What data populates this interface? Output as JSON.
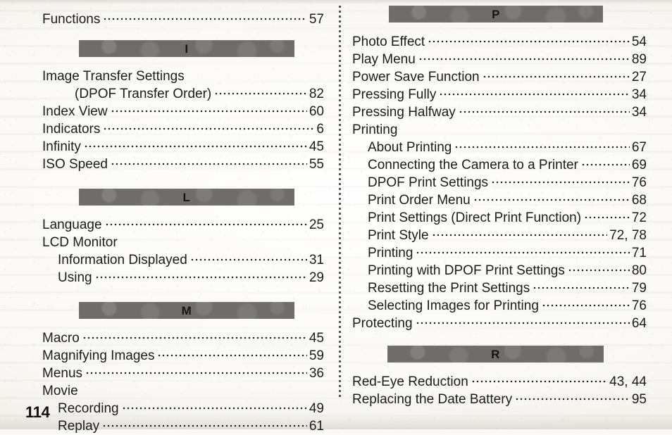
{
  "document": {
    "page_number": "114",
    "type": "index",
    "colors": {
      "section_bar": "#6e6d6a",
      "paper": "#faf9f6",
      "text": "#1c1b1a"
    }
  },
  "left_column": {
    "blocks": [
      {
        "kind": "entries",
        "entries": [
          {
            "label": "Functions",
            "level": 0,
            "page": "57",
            "leader": true
          }
        ]
      },
      {
        "kind": "section",
        "letter": "I"
      },
      {
        "kind": "entries",
        "entries": [
          {
            "label": "Image Transfer Settings",
            "level": 0,
            "page": "",
            "leader": false
          },
          {
            "label": "(DPOF Transfer Order)",
            "level": 2,
            "page": "82",
            "leader": true
          },
          {
            "label": "Index View",
            "level": 0,
            "page": "60",
            "leader": true
          },
          {
            "label": "Indicators",
            "level": 0,
            "page": "6",
            "leader": true
          },
          {
            "label": "Infinity",
            "level": 0,
            "page": "45",
            "leader": true
          },
          {
            "label": "ISO Speed",
            "level": 0,
            "page": "55",
            "leader": true
          }
        ]
      },
      {
        "kind": "section",
        "letter": "L"
      },
      {
        "kind": "entries",
        "entries": [
          {
            "label": "Language",
            "level": 0,
            "page": "25",
            "leader": true
          },
          {
            "label": "LCD Monitor",
            "level": 0,
            "page": "",
            "leader": false
          },
          {
            "label": "Information Displayed",
            "level": 1,
            "page": "31",
            "leader": true
          },
          {
            "label": "Using",
            "level": 1,
            "page": "29",
            "leader": true
          }
        ]
      },
      {
        "kind": "section",
        "letter": "M"
      },
      {
        "kind": "entries",
        "entries": [
          {
            "label": "Macro",
            "level": 0,
            "page": "45",
            "leader": true
          },
          {
            "label": "Magnifying Images",
            "level": 0,
            "page": "59",
            "leader": true
          },
          {
            "label": "Menus",
            "level": 0,
            "page": "36",
            "leader": true
          },
          {
            "label": "Movie",
            "level": 0,
            "page": "",
            "leader": false
          },
          {
            "label": "Recording",
            "level": 1,
            "page": "49",
            "leader": true
          },
          {
            "label": "Replay",
            "level": 1,
            "page": "61",
            "leader": true
          }
        ]
      }
    ]
  },
  "right_column": {
    "blocks": [
      {
        "kind": "section",
        "letter": "P"
      },
      {
        "kind": "entries",
        "entries": [
          {
            "label": "Photo Effect",
            "level": 0,
            "page": "54",
            "leader": true
          },
          {
            "label": "Play Menu",
            "level": 0,
            "page": "89",
            "leader": true
          },
          {
            "label": "Power Save Function",
            "level": 0,
            "page": "27",
            "leader": true
          },
          {
            "label": "Pressing Fully",
            "level": 0,
            "page": "34",
            "leader": true
          },
          {
            "label": "Pressing Halfway",
            "level": 0,
            "page": "34",
            "leader": true
          },
          {
            "label": "Printing",
            "level": 0,
            "page": "",
            "leader": false
          },
          {
            "label": "About Printing",
            "level": 1,
            "page": "67",
            "leader": true
          },
          {
            "label": "Connecting the Camera to a Printer",
            "level": 1,
            "page": "69",
            "leader": true
          },
          {
            "label": "DPOF Print Settings",
            "level": 1,
            "page": "76",
            "leader": true
          },
          {
            "label": "Print Order Menu",
            "level": 1,
            "page": "68",
            "leader": true
          },
          {
            "label": "Print Settings (Direct Print Function)",
            "level": 1,
            "page": "72",
            "leader": true
          },
          {
            "label": "Print Style",
            "level": 1,
            "page": "72, 78",
            "leader": true
          },
          {
            "label": "Printing",
            "level": 1,
            "page": "71",
            "leader": true
          },
          {
            "label": "Printing with DPOF Print Settings",
            "level": 1,
            "page": "80",
            "leader": true
          },
          {
            "label": "Resetting the Print Settings",
            "level": 1,
            "page": "79",
            "leader": true
          },
          {
            "label": "Selecting Images for Printing",
            "level": 1,
            "page": "76",
            "leader": true
          },
          {
            "label": "Protecting",
            "level": 0,
            "page": "64",
            "leader": true
          }
        ]
      },
      {
        "kind": "section",
        "letter": "R"
      },
      {
        "kind": "entries",
        "entries": [
          {
            "label": "Red-Eye Reduction",
            "level": 0,
            "page": "43, 44",
            "leader": true
          },
          {
            "label": "Replacing the Date Battery",
            "level": 0,
            "page": "95",
            "leader": true
          }
        ]
      }
    ]
  }
}
